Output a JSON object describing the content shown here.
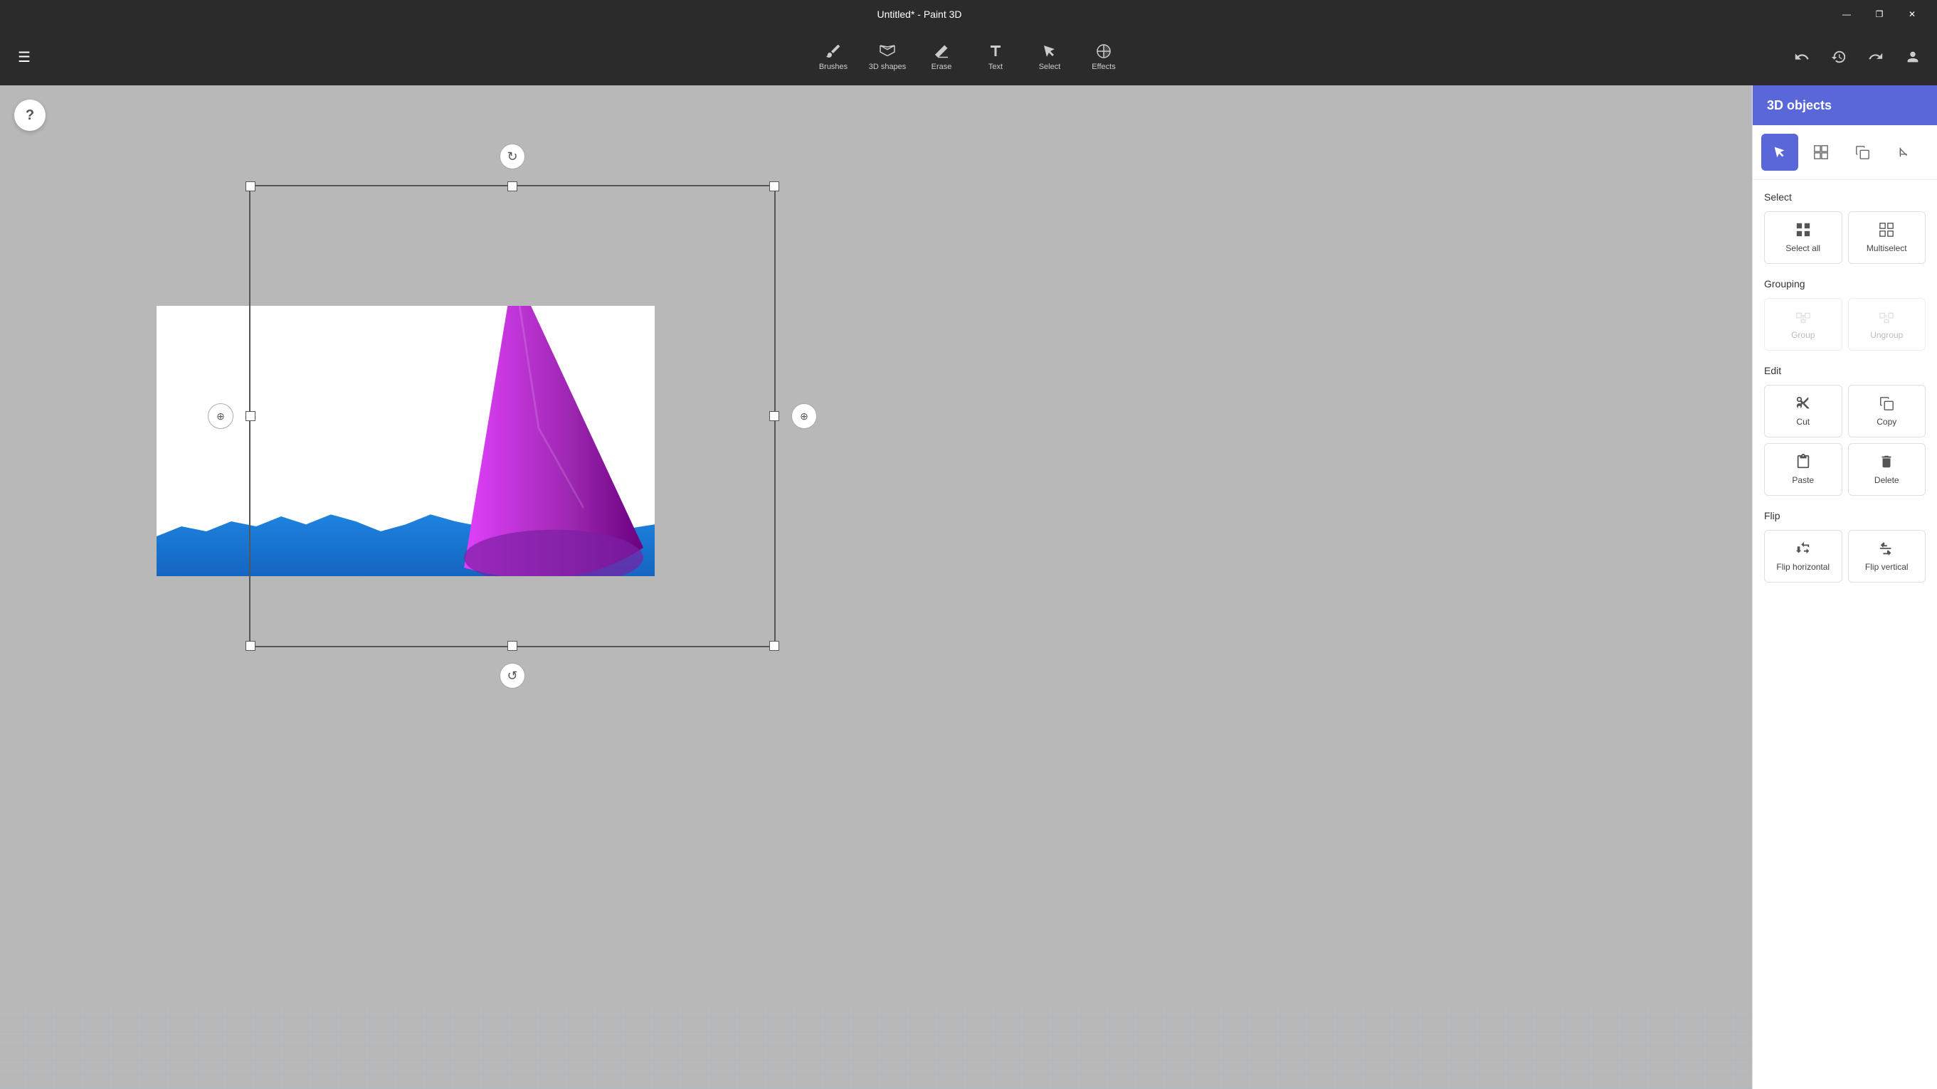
{
  "titlebar": {
    "title": "Untitled* - Paint 3D",
    "minimize_label": "—",
    "maximize_label": "❐",
    "close_label": "✕"
  },
  "toolbar": {
    "hamburger": "☰",
    "tools": [
      {
        "name": "brush-tool",
        "label": "Brushes"
      },
      {
        "name": "3d-tool",
        "label": "3D shapes"
      },
      {
        "name": "erase-tool",
        "label": "Erase"
      },
      {
        "name": "text-tool",
        "label": "Text"
      },
      {
        "name": "select-tool",
        "label": "Select"
      },
      {
        "name": "effects-tool",
        "label": "Effects"
      }
    ],
    "undo_label": "↩",
    "history_label": "🕐",
    "redo_label": "↪",
    "profile_label": "👤"
  },
  "help_button": "?",
  "panel": {
    "title": "3D objects",
    "tabs": [
      {
        "name": "select-tab",
        "label": "⬡",
        "active": true
      },
      {
        "name": "multiselect-tab",
        "label": "⊞"
      },
      {
        "name": "copy-tab",
        "label": "⧉"
      },
      {
        "name": "crop-tab",
        "label": "⊡"
      }
    ],
    "sections": {
      "select": {
        "title": "Select",
        "buttons": [
          {
            "name": "select-all-btn",
            "icon": "select-all",
            "label": "Select all",
            "disabled": false
          },
          {
            "name": "multiselect-btn",
            "icon": "multiselect",
            "label": "Multiselect",
            "disabled": false
          }
        ]
      },
      "grouping": {
        "title": "Grouping",
        "buttons": [
          {
            "name": "group-btn",
            "icon": "group",
            "label": "Group",
            "disabled": true
          },
          {
            "name": "ungroup-btn",
            "icon": "ungroup",
            "label": "Ungroup",
            "disabled": true
          }
        ]
      },
      "edit": {
        "title": "Edit",
        "buttons": [
          {
            "name": "cut-btn",
            "icon": "cut",
            "label": "Cut",
            "disabled": false
          },
          {
            "name": "copy-btn",
            "icon": "copy",
            "label": "Copy",
            "disabled": false
          },
          {
            "name": "paste-btn",
            "icon": "paste",
            "label": "Paste",
            "disabled": false
          },
          {
            "name": "delete-btn",
            "icon": "delete",
            "label": "Delete",
            "disabled": false
          }
        ]
      },
      "flip": {
        "title": "Flip",
        "buttons": [
          {
            "name": "flip-h-btn",
            "icon": "flip-horizontal",
            "label": "Flip horizontal",
            "disabled": false
          },
          {
            "name": "flip-v-btn",
            "icon": "flip-vertical",
            "label": "Flip vertical",
            "disabled": false
          }
        ]
      }
    }
  }
}
